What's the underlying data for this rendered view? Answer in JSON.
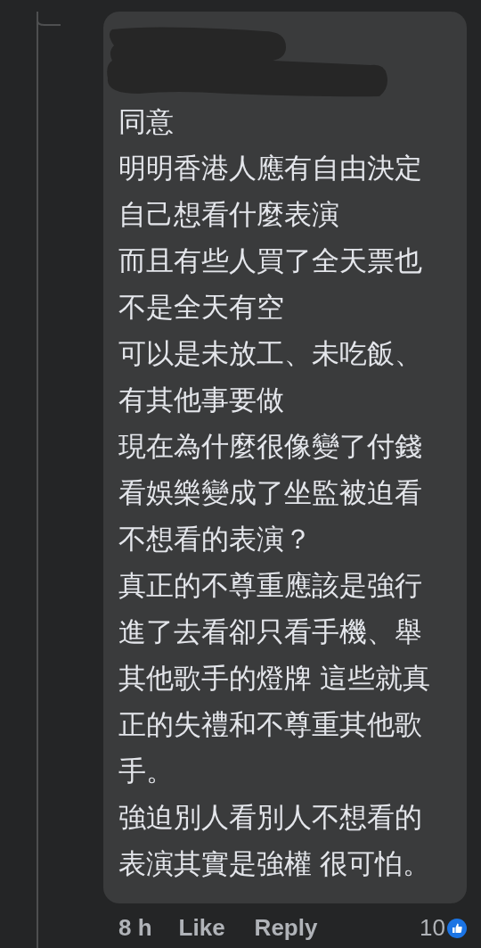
{
  "comment": {
    "lines": [
      "同意",
      "明明香港人應有自由決定",
      "自己想看什麼表演",
      "而且有些人買了全天票也",
      "不是全天有空",
      "可以是未放工、未吃飯、",
      "有其他事要做",
      "現在為什麼很像變了付錢",
      "看娛樂變成了坐監被迫看",
      "不想看的表演？",
      "真正的不尊重應該是強行",
      "進了去看卻只看手機、舉",
      "其他歌手的燈牌 這些就真",
      "正的失禮和不尊重其他歌",
      "手。",
      "強迫別人看別人不想看的",
      "表演其實是強權 很可怕。"
    ],
    "time": "8 h",
    "like": "Like",
    "reply": "Reply",
    "reaction_count": "10"
  }
}
